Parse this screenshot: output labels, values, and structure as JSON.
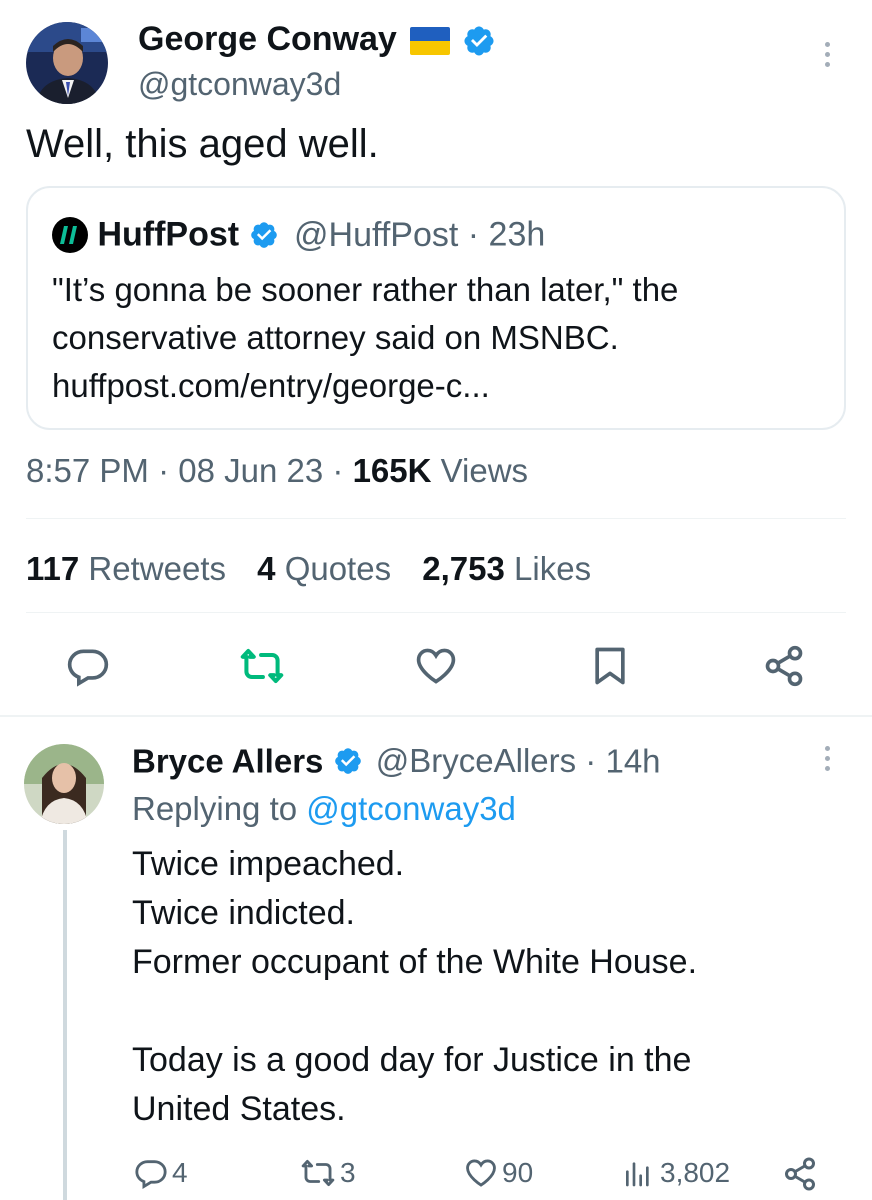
{
  "tweet": {
    "author_name": "George Conway",
    "author_handle": "@gtconway3d",
    "text": "Well, this aged well.",
    "quote": {
      "source_name": "HuffPost",
      "source_handle": "@HuffPost",
      "separator": "·",
      "time": "23h",
      "text_line1": "\"It’s gonna be sooner rather than later,\" the",
      "text_line2": "conservative attorney said on MSNBC.",
      "link": "huffpost.com/entry/george-c..."
    },
    "timestamp": "8:57 PM",
    "date": "08 Jun 23",
    "separator": "·",
    "views_count": "165K",
    "views_label": "Views",
    "stats": {
      "retweets_count": "117",
      "retweets_label": "Retweets",
      "quotes_count": "4",
      "quotes_label": "Quotes",
      "likes_count": "2,753",
      "likes_label": "Likes"
    }
  },
  "reply": {
    "author_name": "Bryce Allers",
    "author_handle": "@BryceAllers",
    "separator": "·",
    "time": "14h",
    "replying_prefix": "Replying to",
    "replying_handle": "@gtconway3d",
    "lines": [
      "Twice impeached.",
      "Twice indicted.",
      "Former occupant of the White House.",
      "Today is a good day for Justice in the",
      "United States."
    ],
    "actions": {
      "replies": "4",
      "retweets": "3",
      "likes": "90",
      "views": "3,802"
    }
  },
  "colors": {
    "verified": "#1d9bf0",
    "retweet_active": "#00ba7c",
    "muted": "#536471",
    "link": "#1d9bf0"
  },
  "icons": [
    "verified-badge-icon",
    "ukraine-flag-icon",
    "more-icon",
    "reply-icon",
    "retweet-icon",
    "like-icon",
    "bookmark-icon",
    "share-icon",
    "views-icon",
    "huffpost-logo"
  ]
}
